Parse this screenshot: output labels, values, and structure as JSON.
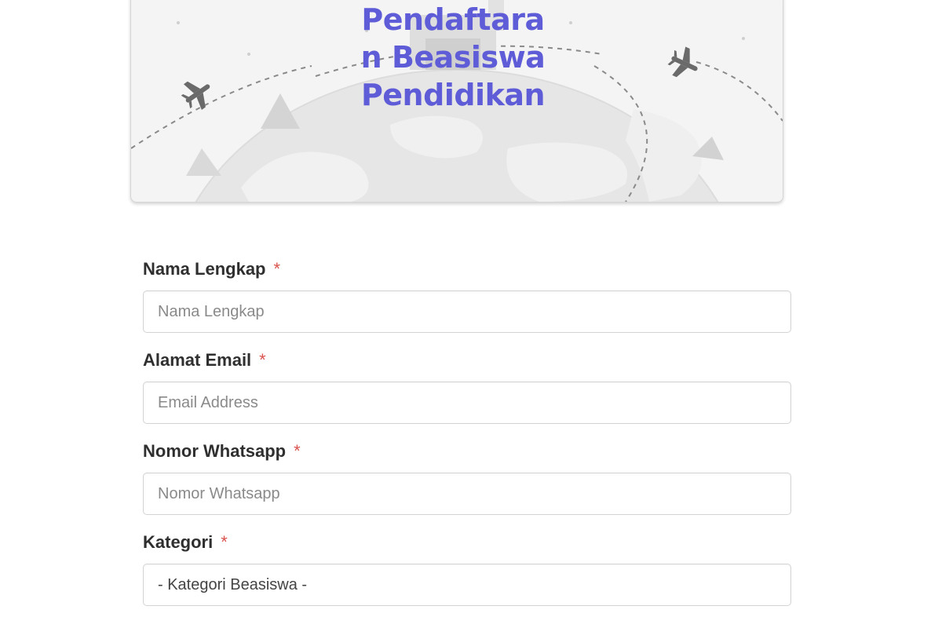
{
  "banner": {
    "title_lines": [
      "Pendaftara",
      "n Beasiswa",
      "Pendidikan"
    ],
    "title_color": "#5f5cd8"
  },
  "form": {
    "required_marker": "*",
    "fields": [
      {
        "label": "Nama Lengkap",
        "placeholder": "Nama Lengkap"
      },
      {
        "label": "Alamat Email",
        "placeholder": "Email Address"
      },
      {
        "label": "Nomor Whatsapp",
        "placeholder": "Nomor Whatsapp"
      }
    ],
    "category": {
      "label": "Kategori",
      "selected": "- Kategori Beasiswa -"
    }
  }
}
